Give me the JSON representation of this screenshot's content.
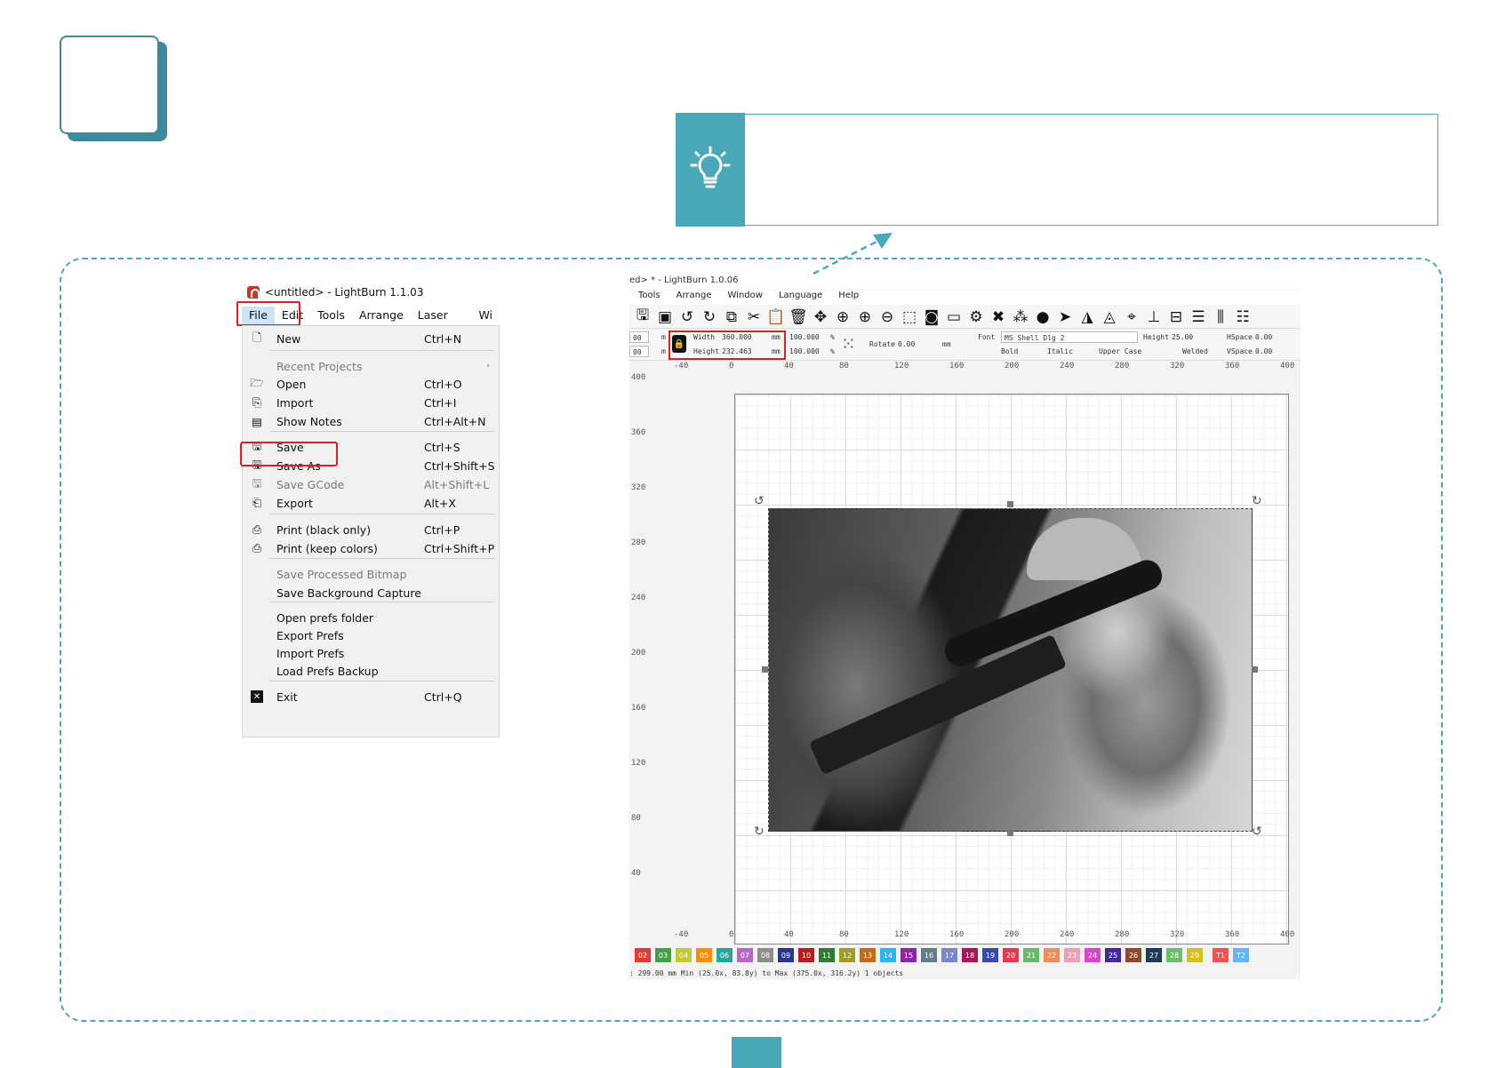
{
  "menu_screenshot": {
    "window_title": "<untitled> - LightBurn 1.1.03",
    "menubar": [
      "File",
      "Edit",
      "Tools",
      "Arrange",
      "Laser Tools",
      "Wi"
    ],
    "items": [
      {
        "label": "New",
        "shortcut": "Ctrl+N",
        "icon": "new-file-icon",
        "disabled": false
      },
      {
        "label": "Recent Projects",
        "shortcut": "",
        "icon": "",
        "disabled": true,
        "submenu": true
      },
      {
        "label": "Open",
        "shortcut": "Ctrl+O",
        "icon": "folder-open-icon",
        "disabled": false
      },
      {
        "label": "Import",
        "shortcut": "Ctrl+I",
        "icon": "import-icon",
        "disabled": false
      },
      {
        "label": "Show Notes",
        "shortcut": "Ctrl+Alt+N",
        "icon": "notes-icon",
        "disabled": false
      },
      {
        "label": "Save",
        "shortcut": "Ctrl+S",
        "icon": "save-icon",
        "disabled": false
      },
      {
        "label": "Save As",
        "shortcut": "Ctrl+Shift+S",
        "icon": "save-as-icon",
        "disabled": false
      },
      {
        "label": "Save GCode",
        "shortcut": "Alt+Shift+L",
        "icon": "save-gcode-icon",
        "disabled": true
      },
      {
        "label": "Export",
        "shortcut": "Alt+X",
        "icon": "export-icon",
        "disabled": false
      },
      {
        "label": "Print (black only)",
        "shortcut": "Ctrl+P",
        "icon": "printer-icon",
        "disabled": false
      },
      {
        "label": "Print (keep colors)",
        "shortcut": "Ctrl+Shift+P",
        "icon": "printer-icon",
        "disabled": false
      },
      {
        "label": "Save Processed Bitmap",
        "shortcut": "",
        "icon": "",
        "disabled": true
      },
      {
        "label": "Save Background Capture",
        "shortcut": "",
        "icon": "",
        "disabled": false
      },
      {
        "label": "Open prefs folder",
        "shortcut": "",
        "icon": "",
        "disabled": false
      },
      {
        "label": "Export Prefs",
        "shortcut": "",
        "icon": "",
        "disabled": false
      },
      {
        "label": "Import Prefs",
        "shortcut": "",
        "icon": "",
        "disabled": false
      },
      {
        "label": "Load Prefs Backup",
        "shortcut": "",
        "icon": "",
        "disabled": false
      },
      {
        "label": "Exit",
        "shortcut": "Ctrl+Q",
        "icon": "exit-icon",
        "disabled": false
      }
    ]
  },
  "lightburn_screenshot": {
    "window_title": "ed> * - LightBurn 1.0.06",
    "menubar": [
      "Tools",
      "Arrange",
      "Window",
      "Language",
      "Help"
    ],
    "props": {
      "x_left": "00",
      "y_left": "00",
      "x_unit": "m",
      "y_unit": "m",
      "width_label": "Width",
      "width_value": "360.000",
      "height_label": "Height",
      "height_value": "232.463",
      "unit_mm": "mm",
      "scale_w": "100.000",
      "scale_h": "100.000",
      "percent": "%",
      "rotate_label": "Rotate",
      "rotate_value": "0.00",
      "rotate_unit": "mm",
      "font_label": "Font",
      "font_value": "MS Shell Dlg 2",
      "height_font_label": "Height",
      "height_font_value": "25.00",
      "hspace_label": "HSpace",
      "hspace_value": "0.00",
      "vspace_label": "VSpace",
      "vspace_value": "0.00",
      "bold": "Bold",
      "italic": "Italic",
      "upper_case": "Upper Case",
      "welded": "Welded"
    },
    "ruler_x": [
      "-40",
      "0",
      "40",
      "80",
      "120",
      "160",
      "200",
      "240",
      "280",
      "320",
      "360",
      "400"
    ],
    "ruler_y": [
      "400",
      "360",
      "320",
      "280",
      "240",
      "200",
      "160",
      "120",
      "80",
      "40"
    ],
    "palette": [
      {
        "label": "02",
        "color": "#e53935"
      },
      {
        "label": "03",
        "color": "#43a047"
      },
      {
        "label": "04",
        "color": "#c0ca33"
      },
      {
        "label": "05",
        "color": "#fb8c00"
      },
      {
        "label": "06",
        "color": "#26a69a"
      },
      {
        "label": "07",
        "color": "#ba68c8"
      },
      {
        "label": "08",
        "color": "#8d8d8d"
      },
      {
        "label": "09",
        "color": "#283593"
      },
      {
        "label": "10",
        "color": "#b71c1c"
      },
      {
        "label": "11",
        "color": "#2e7d32"
      },
      {
        "label": "12",
        "color": "#9e9d24"
      },
      {
        "label": "13",
        "color": "#c56a1a"
      },
      {
        "label": "14",
        "color": "#29b6f6"
      },
      {
        "label": "15",
        "color": "#8e24aa"
      },
      {
        "label": "16",
        "color": "#607d8b"
      },
      {
        "label": "17",
        "color": "#7986cb"
      },
      {
        "label": "18",
        "color": "#ad1457"
      },
      {
        "label": "19",
        "color": "#3949ab"
      },
      {
        "label": "20",
        "color": "#e53950"
      },
      {
        "label": "21",
        "color": "#66bb6a"
      },
      {
        "label": "22",
        "color": "#f48a5a"
      },
      {
        "label": "23",
        "color": "#e8a0b8"
      },
      {
        "label": "24",
        "color": "#d946c7"
      },
      {
        "label": "25",
        "color": "#4527a0"
      },
      {
        "label": "26",
        "color": "#8d4a2a"
      },
      {
        "label": "27",
        "color": "#1f3a5a"
      },
      {
        "label": "28",
        "color": "#6bbf6b"
      },
      {
        "label": "29",
        "color": "#d6c020"
      },
      {
        "label": "T1",
        "color": "#ef5350"
      },
      {
        "label": "T2",
        "color": "#64b5f6"
      }
    ],
    "status_text": ": 299.00 mm    Min (25.0x, 83.8y) to Max (375.0x, 316.2y)   1 objects"
  },
  "colors": {
    "accent": "#4aa9b8",
    "accent_dark": "#3b8a9e",
    "highlight_red": "#e02020"
  }
}
